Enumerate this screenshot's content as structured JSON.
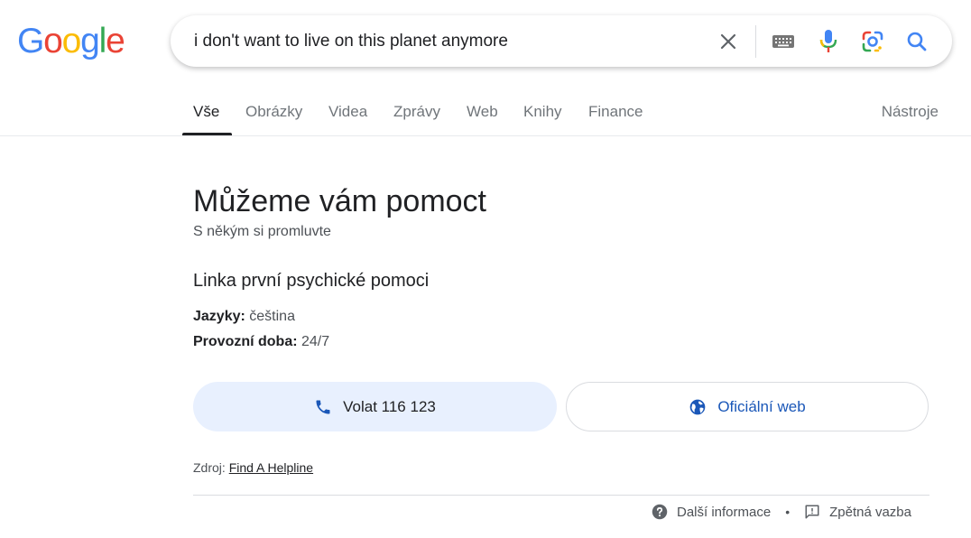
{
  "logo": {
    "letters": [
      "G",
      "o",
      "o",
      "g",
      "l",
      "e"
    ],
    "colors": [
      "#4285f4",
      "#ea4335",
      "#fbbc05",
      "#4285f4",
      "#34a853",
      "#ea4335"
    ]
  },
  "search": {
    "query": "i don't want to live on this planet anymore"
  },
  "tabs": [
    {
      "label": "Vše"
    },
    {
      "label": "Obrázky"
    },
    {
      "label": "Videa"
    },
    {
      "label": "Zprávy"
    },
    {
      "label": "Web"
    },
    {
      "label": "Knihy"
    },
    {
      "label": "Finance"
    }
  ],
  "tools_label": "Nástroje",
  "help": {
    "title": "Můžeme vám pomoct",
    "subtitle": "S někým si promluvte",
    "org_name": "Linka první psychické pomoci",
    "languages_label": "Jazyky:",
    "languages_value": " čeština",
    "hours_label": "Provozní doba:",
    "hours_value": " 24/7",
    "call_label": "Volat 116 123",
    "web_label": "Oficiální web",
    "source_label": "Zdroj: ",
    "source_link": "Find A Helpline"
  },
  "footer": {
    "more_info": "Další informace",
    "feedback": "Zpětná vazba"
  },
  "colors": {
    "accent_blue": "#1a73e8",
    "call_bg": "#e8f0fe",
    "link_blue": "#1a57b8"
  }
}
